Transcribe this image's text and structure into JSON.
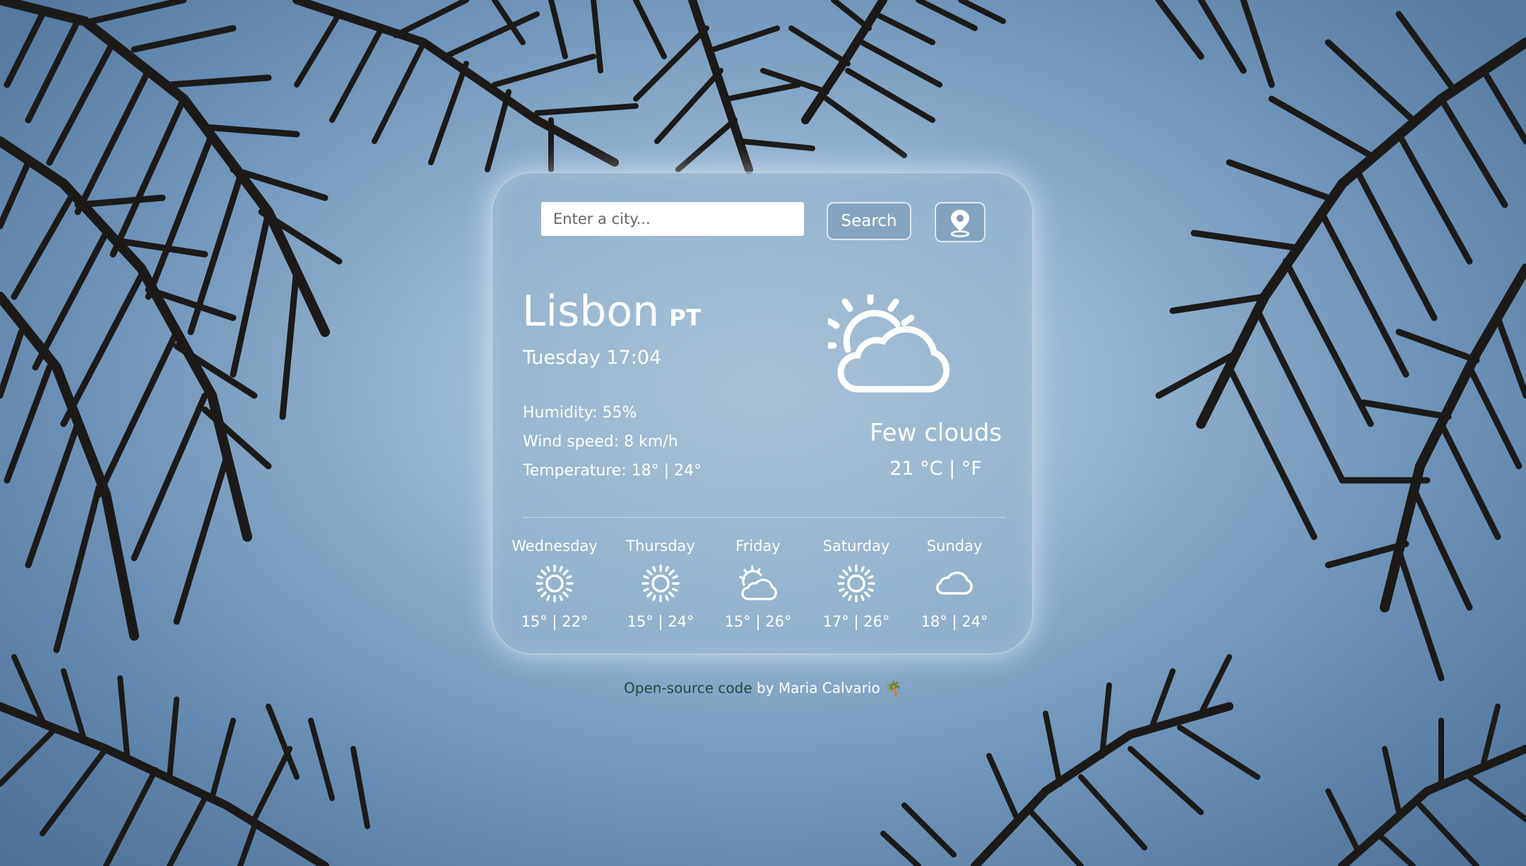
{
  "search": {
    "placeholder": "Enter a city...",
    "button_label": "Search"
  },
  "current": {
    "city": "Lisbon",
    "country": "PT",
    "datetime": "Tuesday 17:04",
    "humidity": "Humidity: 55%",
    "wind": "Wind speed: 8 km/h",
    "temperature_range": "Temperature: 18° | 24°",
    "description": "Few clouds",
    "temperature": "21 °C | °F",
    "icon": "sun-behind-cloud-icon"
  },
  "forecast": [
    {
      "day": "Wednesday",
      "temps": "15° | 22°",
      "icon": "sun-icon"
    },
    {
      "day": "Thursday",
      "temps": "15° | 24°",
      "icon": "sun-icon"
    },
    {
      "day": "Friday",
      "temps": "15° | 26°",
      "icon": "partly-cloudy-icon"
    },
    {
      "day": "Saturday",
      "temps": "17° | 26°",
      "icon": "sun-icon"
    },
    {
      "day": "Sunday",
      "temps": "18° | 24°",
      "icon": "cloud-icon"
    }
  ],
  "footer": {
    "link_text": "Open-source code",
    "text": " by Maria Calvario ",
    "emoji": "🌴"
  },
  "colors": {
    "footer_link": "#1d4d3a",
    "sky": "#7fa3c6",
    "palm": "#1c1a19"
  }
}
